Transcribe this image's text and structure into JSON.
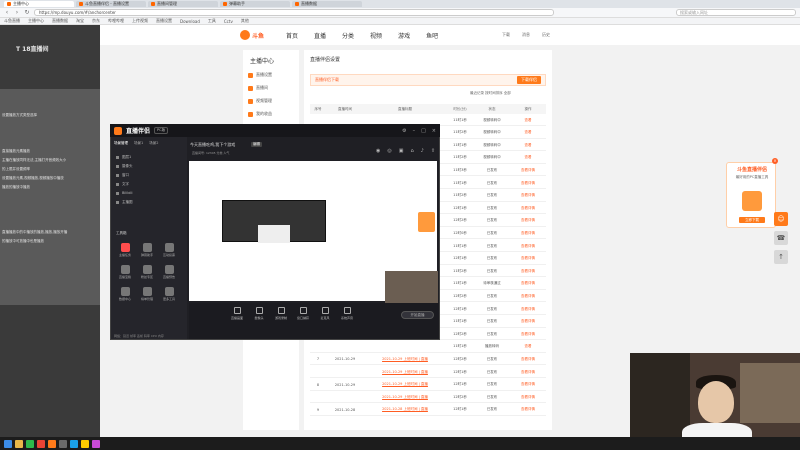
{
  "browser": {
    "tabs": [
      {
        "label": "主播中心",
        "active": true
      },
      {
        "label": "斗鱼直播伴侣 - 直播设置",
        "active": false
      },
      {
        "label": "直播间管理",
        "active": false
      },
      {
        "label": "弹幕助手",
        "active": false
      },
      {
        "label": "直播数据",
        "active": false
      }
    ],
    "url": "https://mp.douyu.com/#/anchorcenter",
    "search_placeholder": "搜索或输入网址",
    "bookmarks": [
      "斗鱼直播",
      "主播中心",
      "直播数据",
      "淘宝",
      "京东",
      "哔哩哔哩",
      "上传视频",
      "直播设置",
      "Download",
      "工具",
      "Cctv",
      "其他"
    ]
  },
  "site": {
    "logo": "斗鱼",
    "nav": [
      "首页",
      "直播",
      "分类",
      "视频",
      "游戏",
      "鱼吧"
    ],
    "header_right": [
      "下载",
      "消息",
      "历史"
    ],
    "left_menu_title": "主播中心",
    "left_menu": [
      "直播设置",
      "直播间",
      "视频管理",
      "我的收益",
      "粉丝管理",
      "主播任务"
    ],
    "page_title": "直播伴侣设置",
    "notice_title": "直播伴侣下载",
    "notice_button": "下载伴侣",
    "filters": "最近记录  按时间排序  全部",
    "table_headers": [
      "序号",
      "直播时间",
      "直播标题",
      "时长(分)",
      "状态",
      "操作"
    ],
    "rows": [
      {
        "idx": "",
        "date": "",
        "title": "",
        "dur": "11时1秒",
        "status": "视频转码中",
        "op": "查看"
      },
      {
        "idx": "",
        "date": "",
        "title": "",
        "dur": "11时2秒",
        "status": "视频转码中",
        "op": "查看"
      },
      {
        "idx": "",
        "date": "",
        "title": "",
        "dur": "11时1秒",
        "status": "视频转码中",
        "op": "查看"
      },
      {
        "idx": "",
        "date": "",
        "title": "",
        "dur": "11时2秒",
        "status": "视频转码中",
        "op": "查看"
      },
      {
        "idx": "",
        "date": "",
        "title": "",
        "dur": "11时3秒",
        "status": "已发布",
        "op": "查看详情"
      },
      {
        "idx": "",
        "date": "",
        "title": "",
        "dur": "11时1秒",
        "status": "已发布",
        "op": "查看详情"
      },
      {
        "idx": "",
        "date": "",
        "title": "",
        "dur": "11时2秒",
        "status": "已发布",
        "op": "查看详情"
      },
      {
        "idx": "",
        "date": "",
        "title": "",
        "dur": "12时1秒",
        "status": "已发布",
        "op": "查看详情"
      },
      {
        "idx": "",
        "date": "",
        "title": "",
        "dur": "12时2秒",
        "status": "已发布",
        "op": "查看详情"
      },
      {
        "idx": "",
        "date": "",
        "title": "",
        "dur": "12时0秒",
        "status": "已发布",
        "op": "查看详情"
      },
      {
        "idx": "",
        "date": "",
        "title": "",
        "dur": "11时1秒",
        "status": "已发布",
        "op": "查看详情"
      },
      {
        "idx": "",
        "date": "",
        "title": "",
        "dur": "12时1秒",
        "status": "已发布",
        "op": "查看详情"
      },
      {
        "idx": "",
        "date": "",
        "title": "",
        "dur": "11时2秒",
        "status": "已发布",
        "op": "查看详情"
      },
      {
        "idx": "",
        "date": "",
        "title": "",
        "dur": "11时1秒",
        "status": "待审核通过",
        "op": "查看详情"
      },
      {
        "idx": "",
        "date": "",
        "title": "",
        "dur": "12时2秒",
        "status": "已发布",
        "op": "查看详情"
      },
      {
        "idx": "",
        "date": "",
        "title": "",
        "dur": "12时1秒",
        "status": "已发布",
        "op": "查看详情"
      },
      {
        "idx": "",
        "date": "",
        "title": "",
        "dur": "11时1秒",
        "status": "已发布",
        "op": "查看详情"
      },
      {
        "idx": "",
        "date": "",
        "title": "",
        "dur": "12时2秒",
        "status": "已发布",
        "op": "查看详情"
      },
      {
        "idx": "",
        "date": "",
        "title": "",
        "dur": "11时1秒",
        "status": "播放转码",
        "op": "查看"
      },
      {
        "idx": "7",
        "date": "2021-10-29",
        "title": "2021-10-29 上班时间 | 直播",
        "dur": "12时2秒",
        "status": "已发布",
        "op": "查看详情"
      },
      {
        "idx": "",
        "date": "",
        "title": "2021-10-29 上班时间 | 直播",
        "dur": "12时1秒",
        "status": "已发布",
        "op": "查看详情"
      },
      {
        "idx": "8",
        "date": "2021-10-29",
        "title": "2021-10-29 上班时间 | 直播",
        "dur": "12时1秒",
        "status": "已发布",
        "op": "查看详情"
      },
      {
        "idx": "",
        "date": "",
        "title": "2021-10-29 上班时间 | 直播",
        "dur": "12时2秒",
        "status": "已发布",
        "op": "查看详情"
      },
      {
        "idx": "9",
        "date": "2021-10-28",
        "title": "2021-10-28 上班时间 | 直播",
        "dur": "12时1秒",
        "status": "已发布",
        "op": "查看详情"
      }
    ],
    "promo_title": "斗鱼直播伴侣",
    "promo_sub": "最好用的PC直播工具",
    "promo_button": "立即下载"
  },
  "overlay": {
    "top_left_label": "T 18直播间",
    "grey_panel_lines": [
      "",
      "",
      "设置播放方式类型选择",
      "",
      "",
      "",
      "直接播放元素播放",
      "主播在播放同样无法,主播打开音频效大小",
      "的上限并设置频率",
      "设置播放元素,视频播放,视频播放中播放",
      "播放的播放中播放",
      "",
      "",
      "",
      "",
      "直播播放中的中播放的播放,播放,播放开播",
      "的播放中可放播中也是播放"
    ]
  },
  "app": {
    "title": "直播伴侣",
    "version": "PC版",
    "tabs": [
      "场景管理",
      "场景1",
      "场景2"
    ],
    "scenes": [
      "图层1",
      "摄像头",
      "窗口",
      "文字",
      "Bilibili",
      "主播图"
    ],
    "stream_title": "今天直播吃鸡,我下个游戏",
    "stream_badge": "编辑",
    "stream_sub": "直播间号: 12345  分类  人气",
    "tools_title": "工具箱",
    "tools": [
      "主播任务",
      "弹幕助手",
      "互动投票",
      "直播宝箱",
      "粉丝专区",
      "直播预告",
      "数据中心",
      "榜单管理",
      "更多工具"
    ],
    "bottom": [
      "直播画面",
      "摄像头",
      "游戏录制",
      "窗口捕获",
      "麦克风",
      "系统声音"
    ],
    "start_live": "开始直播",
    "footer": "网络：延迟 帧率 丢帧 码率 CPU 内存"
  },
  "webcam_label": "主播摄像头"
}
